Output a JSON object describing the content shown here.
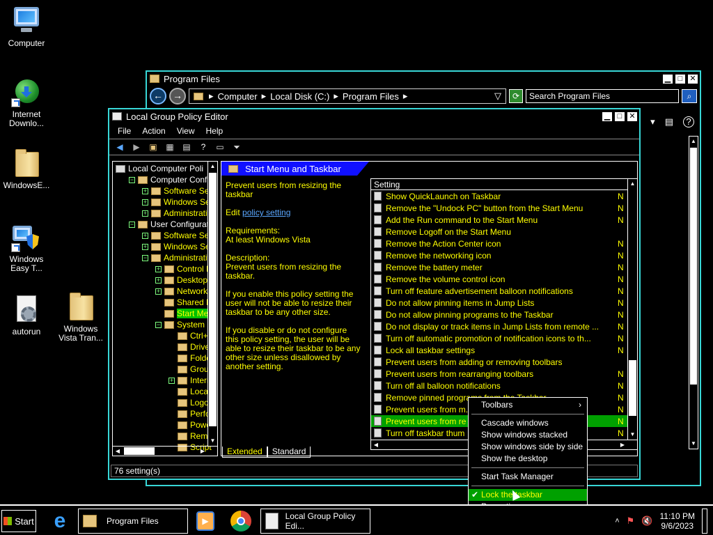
{
  "desktop": {
    "icons": [
      {
        "label": "Computer"
      },
      {
        "label": "Internet Downlo..."
      },
      {
        "label": "WindowsE..."
      },
      {
        "label": "Windows Easy T..."
      },
      {
        "label": "autorun"
      },
      {
        "label": "Windows Vista Tran..."
      }
    ]
  },
  "explorer": {
    "title": "Program Files",
    "breadcrumb": [
      "Computer",
      "Local Disk (C:)",
      "Program Files"
    ],
    "search_placeholder": "Search Program Files"
  },
  "gpe": {
    "title": "Local Group Policy Editor",
    "menu": [
      "File",
      "Action",
      "View",
      "Help"
    ],
    "tree": [
      {
        "label": "Local Computer Poli",
        "level": 0,
        "pm": ""
      },
      {
        "label": "Computer Configu",
        "level": 1,
        "pm": "−"
      },
      {
        "label": "Software Set",
        "level": 2,
        "pm": "+"
      },
      {
        "label": "Windows Set",
        "level": 2,
        "pm": "+"
      },
      {
        "label": "Administrativ",
        "level": 2,
        "pm": "+"
      },
      {
        "label": "User Configuratio",
        "level": 1,
        "pm": "−"
      },
      {
        "label": "Software Set",
        "level": 2,
        "pm": "+"
      },
      {
        "label": "Windows Set",
        "level": 2,
        "pm": "+"
      },
      {
        "label": "Administrativ",
        "level": 2,
        "pm": "−"
      },
      {
        "label": "Control Pa",
        "level": 3,
        "pm": "+"
      },
      {
        "label": "Desktop",
        "level": 3,
        "pm": "+"
      },
      {
        "label": "Network",
        "level": 3,
        "pm": "+"
      },
      {
        "label": "Shared Fo",
        "level": 3,
        "pm": ""
      },
      {
        "label": "Start Men",
        "level": 3,
        "pm": "",
        "selected": true
      },
      {
        "label": "System",
        "level": 3,
        "pm": "−"
      },
      {
        "label": "Ctrl+Al",
        "level": 4,
        "pm": ""
      },
      {
        "label": "Driver",
        "level": 4,
        "pm": ""
      },
      {
        "label": "Folder",
        "level": 4,
        "pm": ""
      },
      {
        "label": "Group",
        "level": 4,
        "pm": ""
      },
      {
        "label": "Interne",
        "level": 4,
        "pm": "+"
      },
      {
        "label": "Locale",
        "level": 4,
        "pm": ""
      },
      {
        "label": "Logon",
        "level": 4,
        "pm": ""
      },
      {
        "label": "Perfor",
        "level": 4,
        "pm": ""
      },
      {
        "label": "Power",
        "level": 4,
        "pm": ""
      },
      {
        "label": "Remov",
        "level": 4,
        "pm": ""
      },
      {
        "label": "Script",
        "level": 4,
        "pm": ""
      }
    ],
    "header": "Start Menu and Taskbar",
    "desc": {
      "title": "Prevent users from resizing the taskbar",
      "edit_prefix": "Edit",
      "edit_link": "policy setting",
      "requirements": "Requirements:",
      "requirements_value": "At least Windows Vista",
      "description": "Description:",
      "description_value": "Prevent users from resizing the taskbar.",
      "p1": "If you enable this policy setting the user will not be able to resize their taskbar to be any other size.",
      "p2": "If you disable or do not configure this policy setting, the user will be able to resize their taskbar to be any other size unless disallowed by another setting."
    },
    "list_header": "Setting",
    "settings": [
      {
        "label": "Show QuickLaunch on Taskbar",
        "state": "N"
      },
      {
        "label": "Remove the \"Undock PC\" button from the Start Menu",
        "state": "N"
      },
      {
        "label": "Add the Run command to the Start Menu",
        "state": "N"
      },
      {
        "label": "Remove Logoff on the Start Menu",
        "state": ""
      },
      {
        "label": "Remove the Action Center icon",
        "state": "N"
      },
      {
        "label": "Remove the networking icon",
        "state": "N"
      },
      {
        "label": "Remove the battery meter",
        "state": "N"
      },
      {
        "label": "Remove the volume control icon",
        "state": "N"
      },
      {
        "label": "Turn off feature advertisement balloon notifications",
        "state": "N"
      },
      {
        "label": "Do not allow pinning items in Jump Lists",
        "state": "N"
      },
      {
        "label": "Do not allow pinning programs to the Taskbar",
        "state": "N"
      },
      {
        "label": "Do not display or track items in Jump Lists from remote ...",
        "state": "N"
      },
      {
        "label": "Turn off automatic promotion of notification icons to th...",
        "state": "N"
      },
      {
        "label": "Lock all taskbar settings",
        "state": "N"
      },
      {
        "label": "Prevent users from adding or removing toolbars",
        "state": ""
      },
      {
        "label": "Prevent users from rearranging toolbars",
        "state": "N"
      },
      {
        "label": "Turn off all balloon notifications",
        "state": "N"
      },
      {
        "label": "Remove pinned programs from the Taskbar",
        "state": "N"
      },
      {
        "label": "Prevent users from m...                                          n d...",
        "state": "N"
      },
      {
        "label": "Prevent users from re",
        "state": "N",
        "selected": true
      },
      {
        "label": "Turn off taskbar thum",
        "state": "N"
      }
    ],
    "tabs": [
      "Extended",
      "Standard"
    ],
    "status": "76 setting(s)"
  },
  "context_menu": {
    "items": [
      {
        "label": "Toolbars",
        "submenu": true
      },
      {
        "sep": true
      },
      {
        "label": "Cascade windows"
      },
      {
        "label": "Show windows stacked"
      },
      {
        "label": "Show windows side by side"
      },
      {
        "label": "Show the desktop"
      },
      {
        "sep": true
      },
      {
        "label": "Start Task Manager"
      },
      {
        "sep": true
      },
      {
        "label": "Lock the taskbar",
        "checked": true,
        "selected": true
      },
      {
        "label": "Properties"
      }
    ]
  },
  "taskbar": {
    "start": "Start",
    "buttons": [
      "Program Files",
      "Local Group Policy Edi..."
    ],
    "time": "11:10 PM",
    "date": "9/6/2023"
  }
}
